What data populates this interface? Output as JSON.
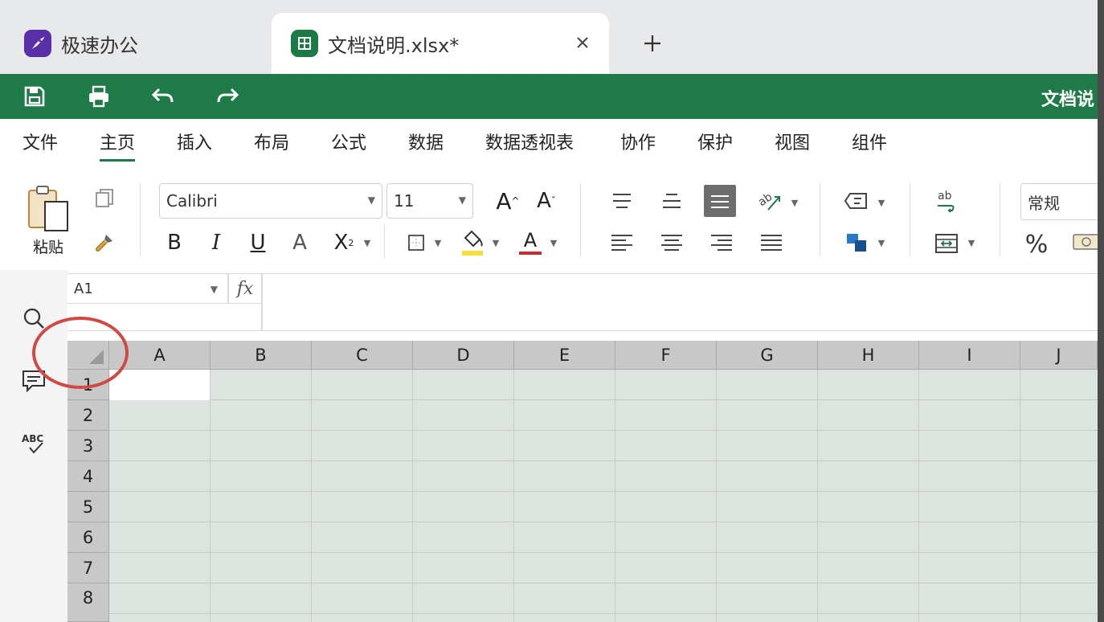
{
  "tabs": {
    "app_tab_label": "极速办公",
    "doc_tab_label": "文档说明.xlsx*"
  },
  "quick_access": {
    "doc_title": "文档说"
  },
  "menu": {
    "items": [
      "文件",
      "主页",
      "插入",
      "布局",
      "公式",
      "数据",
      "数据透视表",
      "协作",
      "保护",
      "视图",
      "组件"
    ],
    "active": "主页"
  },
  "ribbon": {
    "paste_label": "粘贴",
    "font_name": "Calibri",
    "font_size": "11",
    "grow_font": "A",
    "shrink_font": "A",
    "bold": "B",
    "italic": "I",
    "underline": "U",
    "strikethrough": "A",
    "subscript": "X",
    "font_color_letter": "A",
    "number_format": "常规",
    "percent": "%"
  },
  "formula_bar": {
    "cell_ref": "A1",
    "fx_label": "fx"
  },
  "grid": {
    "columns": [
      "A",
      "B",
      "C",
      "D",
      "E",
      "F",
      "G",
      "H",
      "I",
      "J"
    ],
    "rows": [
      "1",
      "2",
      "3",
      "4",
      "5",
      "6",
      "7",
      "8"
    ]
  },
  "colors": {
    "accent_green": "#1e7a46",
    "annotation_red": "#cf4a44"
  }
}
